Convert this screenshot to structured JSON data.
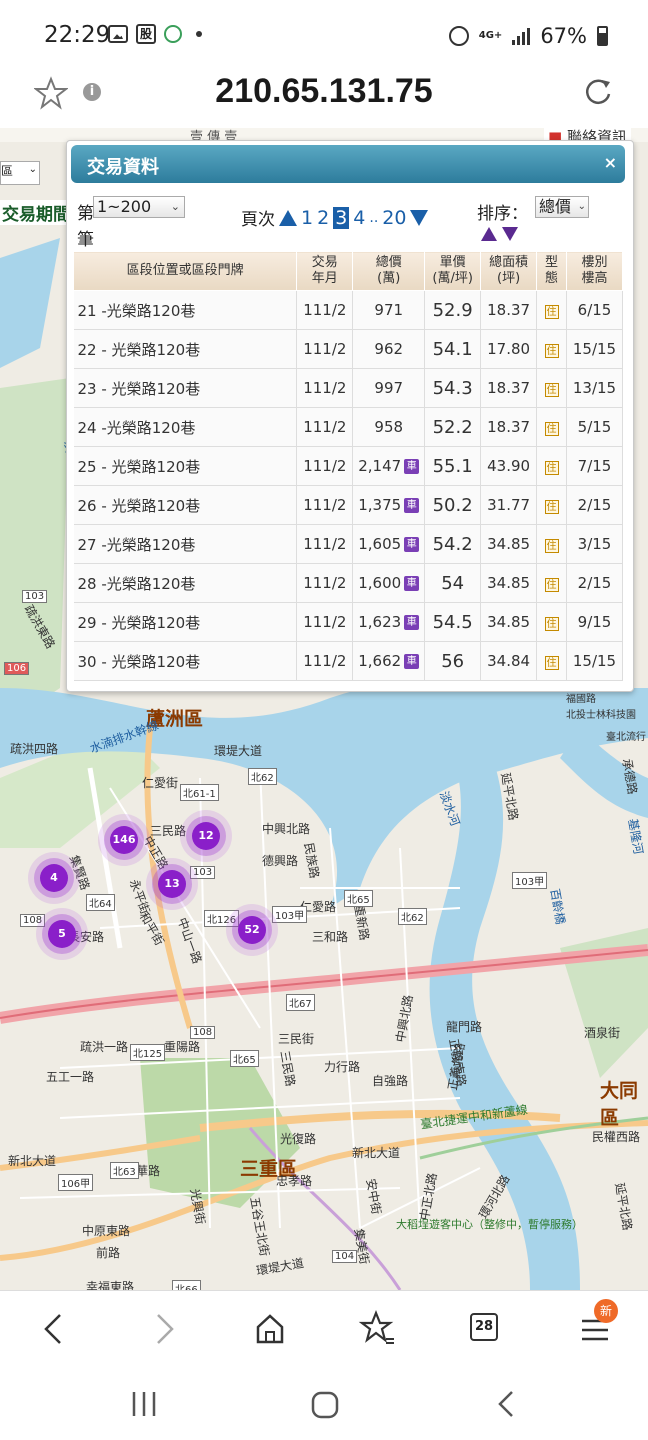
{
  "status_bar": {
    "time": "22:29",
    "gu_label": "股",
    "network": "4G+",
    "battery": "67%",
    "icons": [
      "gallery-icon",
      "stock-icon",
      "android-face-icon",
      "dot-icon",
      "alarm-icon",
      "network-icon",
      "signal-icon",
      "battery-icon"
    ]
  },
  "browser": {
    "url": "210.65.131.75",
    "tab_count": "28",
    "new_badge": "新"
  },
  "map": {
    "left_select_value": "區",
    "left_period_label": "交易期間",
    "contact_label": "聯絡資訊",
    "top_strip_text": "壹     傳     壹",
    "districts": [
      "蘆洲區",
      "三重區",
      "大同區"
    ],
    "labels": [
      "北投士林科技園",
      "福國路",
      "疏洪四路",
      "水湳排水幹線",
      "環堤大道",
      "仁愛街",
      "中正路",
      "三民路",
      "集賢路",
      "長安路",
      "永平街",
      "和平街",
      "中山一路",
      "中興北路",
      "三和路",
      "仁愛路",
      "重新路",
      "三民街",
      "力行路",
      "自強路",
      "正義南路",
      "龍門路",
      "中興北路",
      "新北大道",
      "正義北路",
      "臺北捷運中和新蘆線",
      "大稻埕遊客中心（整修中，暫停服務）",
      "環河北路",
      "延平北路",
      "民權西路",
      "酒泉街",
      "光華路",
      "中原東路",
      "五谷王北街",
      "環堤大道",
      "集美街",
      "安中街",
      "中正北路",
      "忠孝路",
      "光興街",
      "五工一路",
      "疏洪一路",
      "新北大道",
      "前路",
      "重陽路",
      "幸福東路",
      "淡水河",
      "淡水河",
      "基隆河",
      "承德路",
      "百齡橋",
      "疏洪東路",
      "德興路",
      "民族路",
      "臺北流行",
      "延平北路",
      "三民路",
      "光復路"
    ],
    "road_tags": [
      "北62",
      "北61-1",
      "北64",
      "103",
      "北126",
      "103甲",
      "北65",
      "北62",
      "北67",
      "北65",
      "北125",
      "108",
      "108",
      "北63",
      "106甲",
      "104",
      "北66",
      "103",
      "103甲",
      "106"
    ],
    "clusters": [
      "146",
      "12",
      "13",
      "4",
      "5",
      "52"
    ]
  },
  "panel": {
    "title": "交易資料",
    "close": "×",
    "record_prefix": "第",
    "record_suffix": "筆",
    "record_range": "1~200",
    "page_label": "頁次",
    "pages": [
      "1",
      "2",
      "3",
      "4",
      "..",
      "20"
    ],
    "current_page": "3",
    "sort_label": "排序：",
    "sort_value": "總價",
    "headers": {
      "addr": "區段位置或區段門牌",
      "date": "交易\n年月",
      "total": "總價\n(萬)",
      "unit": "單價\n(萬/坪)",
      "area": "總面積\n(坪)",
      "type": "型\n態",
      "floor": "樓別\n樓高"
    },
    "type_badge": "住",
    "parking_badge": "車",
    "rows": [
      {
        "addr": "21 -光榮路120巷",
        "date": "111/2",
        "total": "971",
        "car": false,
        "unit": "52.9",
        "area": "18.37",
        "floor": "6/15"
      },
      {
        "addr": "22 - 光榮路120巷",
        "date": "111/2",
        "total": "962",
        "car": false,
        "unit": "54.1",
        "area": "17.80",
        "floor": "15/15"
      },
      {
        "addr": "23 - 光榮路120巷",
        "date": "111/2",
        "total": "997",
        "car": false,
        "unit": "54.3",
        "area": "18.37",
        "floor": "13/15"
      },
      {
        "addr": "24 -光榮路120巷",
        "date": "111/2",
        "total": "958",
        "car": false,
        "unit": "52.2",
        "area": "18.37",
        "floor": "5/15"
      },
      {
        "addr": "25 - 光榮路120巷",
        "date": "111/2",
        "total": "2,147",
        "car": true,
        "unit": "55.1",
        "area": "43.90",
        "floor": "7/15"
      },
      {
        "addr": "26 - 光榮路120巷",
        "date": "111/2",
        "total": "1,375",
        "car": true,
        "unit": "50.2",
        "area": "31.77",
        "floor": "2/15"
      },
      {
        "addr": "27 -光榮路120巷",
        "date": "111/2",
        "total": "1,605",
        "car": true,
        "unit": "54.2",
        "area": "34.85",
        "floor": "3/15"
      },
      {
        "addr": "28 -光榮路120巷",
        "date": "111/2",
        "total": "1,600",
        "car": true,
        "unit": "54",
        "area": "34.85",
        "floor": "2/15"
      },
      {
        "addr": "29 - 光榮路120巷",
        "date": "111/2",
        "total": "1,623",
        "car": true,
        "unit": "54.5",
        "area": "34.85",
        "floor": "9/15"
      },
      {
        "addr": "30 - 光榮路120巷",
        "date": "111/2",
        "total": "1,662",
        "car": true,
        "unit": "56",
        "area": "34.84",
        "floor": "15/15"
      }
    ]
  },
  "colors": {
    "panel_header": "#2d7c9c",
    "page_link": "#1a5fa8",
    "cluster": "#8a1fc9",
    "river": "#a8d4ea",
    "district_label": "#8b3a00"
  }
}
